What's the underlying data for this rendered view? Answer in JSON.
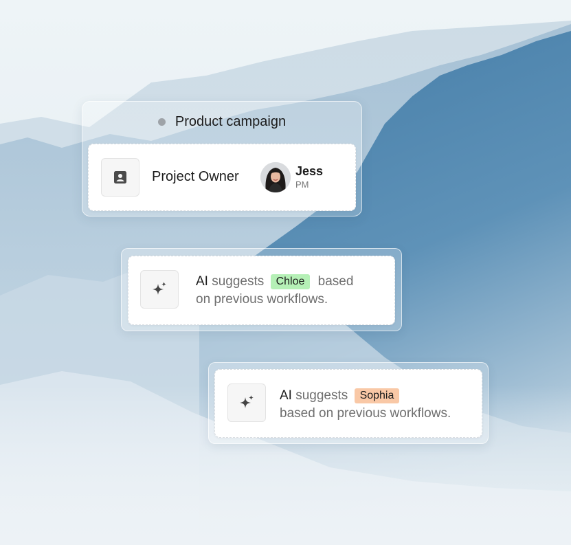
{
  "group": {
    "title": "Product campaign",
    "owner_label": "Project Owner",
    "owner_icon": "contact-card-icon",
    "person": {
      "name": "Jess",
      "role": "PM"
    }
  },
  "suggestions": [
    {
      "icon": "sparkle-icon",
      "ai_word": "AI",
      "verb": "suggests",
      "name": "Chloe",
      "name_color": "#b5f0b6",
      "tail_line1": "based",
      "tail_line2": "on previous workflows."
    },
    {
      "icon": "sparkle-icon",
      "ai_word": "AI",
      "verb": "suggests",
      "name": "Sophia",
      "name_color": "#f9c8a6",
      "tail": "based on previous workflows."
    }
  ],
  "colors": {
    "status_dot": "#9ea3a8",
    "mountain_blue": "#3f7aa6"
  }
}
